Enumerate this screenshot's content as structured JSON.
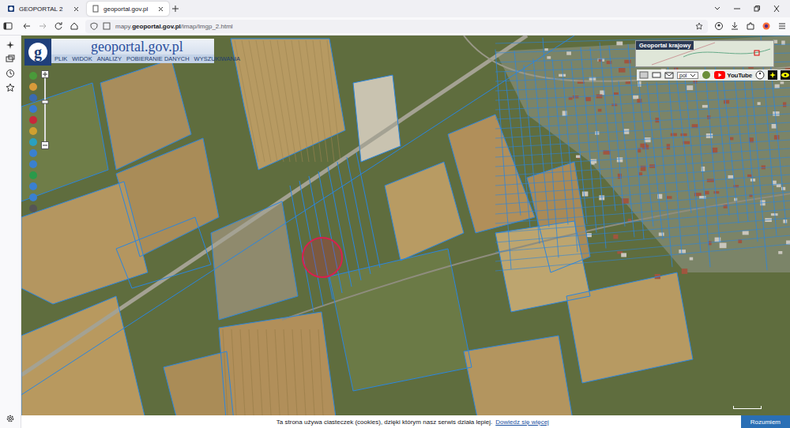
{
  "browser": {
    "tabs": [
      {
        "label": "GEOPORTAL 2",
        "selected": false
      },
      {
        "label": "geoportal.gov.pl",
        "selected": true
      }
    ],
    "url": {
      "prefix": "mapy.",
      "domain": "geoportal.gov.pl",
      "path": "/imap/Imgp_2.html"
    }
  },
  "geoportal": {
    "logo": "g",
    "title": "geoportal.gov.pl",
    "menu": [
      "PLIK",
      "WIDOK",
      "ANALIZY",
      "POBIERANIE DANYCH",
      "WYSZUKIWANIA"
    ],
    "overview": {
      "title": "Geoportal krajowy"
    },
    "language": "pol",
    "youtube": "YouTube"
  },
  "cookie": {
    "text": "Ta strona używa ciasteczek (cookies), dzięki którym nasz serwis działa lepiej.",
    "link": "Dowiedz się więcej",
    "button": "Rozumiem"
  }
}
